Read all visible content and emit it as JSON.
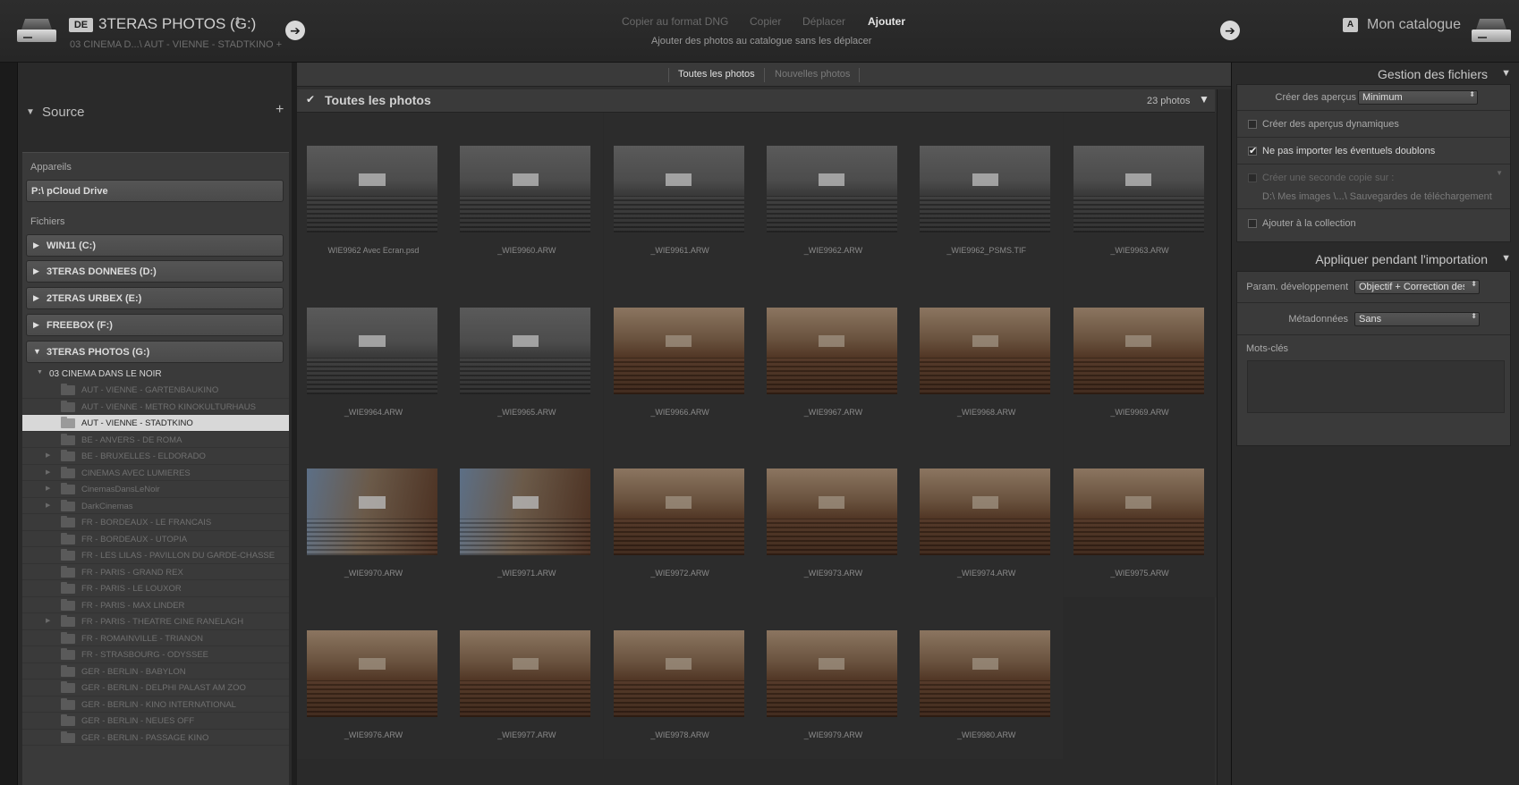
{
  "source": {
    "badge": "DE",
    "title": "3TERAS PHOTOS (G:)",
    "updown": "⬍",
    "path": "03 CINEMA D...\\ AUT - VIENNE - STADTKINO +"
  },
  "modes": {
    "dng": "Copier au format DNG",
    "copy": "Copier",
    "move": "Déplacer",
    "add": "Ajouter",
    "description": "Ajouter des photos au catalogue sans les déplacer"
  },
  "destination": {
    "badge": "A",
    "title": "Mon catalogue"
  },
  "left": {
    "source_title": "Source",
    "add_icon": "+",
    "devices_label": "Appareils",
    "devices": [
      "P:\\ pCloud Drive"
    ],
    "files_label": "Fichiers",
    "drives": [
      {
        "tri": "▶",
        "label": "WIN11 (C:)"
      },
      {
        "tri": "▶",
        "label": "3TERAS DONNEES (D:)"
      },
      {
        "tri": "▶",
        "label": "2TERAS URBEX (E:)"
      },
      {
        "tri": "▶",
        "label": "FREEBOX (F:)"
      },
      {
        "tri": "▼",
        "label": "3TERAS PHOTOS (G:)"
      }
    ],
    "root_folder": "03 CINEMA DANS LE NOIR",
    "folders": [
      {
        "label": "AUT - VIENNE - GARTENBAUKINO",
        "expandable": false
      },
      {
        "label": "AUT - VIENNE - METRO KINOKULTURHAUS",
        "expandable": false
      },
      {
        "label": "AUT - VIENNE - STADTKINO",
        "expandable": false,
        "selected": true
      },
      {
        "label": "BE - ANVERS - DE ROMA",
        "expandable": false
      },
      {
        "label": "BE - BRUXELLES - ELDORADO",
        "expandable": true
      },
      {
        "label": "CINEMAS AVEC LUMIERES",
        "expandable": true
      },
      {
        "label": "CinemasDansLeNoir",
        "expandable": true
      },
      {
        "label": "DarkCinemas",
        "expandable": true
      },
      {
        "label": "FR - BORDEAUX - LE FRANCAIS",
        "expandable": false
      },
      {
        "label": "FR - BORDEAUX - UTOPIA",
        "expandable": false
      },
      {
        "label": "FR - LES LILAS - PAVILLON DU GARDE-CHASSE",
        "expandable": false
      },
      {
        "label": "FR - PARIS - GRAND REX",
        "expandable": false
      },
      {
        "label": "FR - PARIS - LE LOUXOR",
        "expandable": false
      },
      {
        "label": "FR - PARIS - MAX LINDER",
        "expandable": false
      },
      {
        "label": "FR - PARIS - THEATRE CINE RANELAGH",
        "expandable": true
      },
      {
        "label": "FR - ROMAINVILLE - TRIANON",
        "expandable": false
      },
      {
        "label": "FR - STRASBOURG - ODYSSEE",
        "expandable": false
      },
      {
        "label": "GER - BERLIN - BABYLON",
        "expandable": false
      },
      {
        "label": "GER - BERLIN - DELPHI PALAST AM ZOO",
        "expandable": false
      },
      {
        "label": "GER - BERLIN - KINO INTERNATIONAL",
        "expandable": false
      },
      {
        "label": "GER - BERLIN - NEUES OFF",
        "expandable": false
      },
      {
        "label": "GER - BERLIN - PASSAGE KINO",
        "expandable": false
      }
    ]
  },
  "center": {
    "tab_all": "Toutes les photos",
    "tab_new": "Nouvelles photos",
    "grid_check": "✔",
    "grid_title": "Toutes les photos",
    "grid_count": "23 photos",
    "photos": [
      {
        "name": "WIE9962 Avec Ecran.psd",
        "tone": "grey"
      },
      {
        "name": "_WIE9960.ARW",
        "tone": "grey"
      },
      {
        "name": "_WIE9961.ARW",
        "tone": "grey"
      },
      {
        "name": "_WIE9962.ARW",
        "tone": "grey"
      },
      {
        "name": "_WIE9962_PSMS.TIF",
        "tone": "grey"
      },
      {
        "name": "_WIE9963.ARW",
        "tone": "grey"
      },
      {
        "name": "_WIE9964.ARW",
        "tone": "grey"
      },
      {
        "name": "_WIE9965.ARW",
        "tone": "grey"
      },
      {
        "name": "_WIE9966.ARW",
        "tone": "warm"
      },
      {
        "name": "_WIE9967.ARW",
        "tone": "warm"
      },
      {
        "name": "_WIE9968.ARW",
        "tone": "warm"
      },
      {
        "name": "_WIE9969.ARW",
        "tone": "warm"
      },
      {
        "name": "_WIE9970.ARW",
        "tone": "blue"
      },
      {
        "name": "_WIE9971.ARW",
        "tone": "blue"
      },
      {
        "name": "_WIE9972.ARW",
        "tone": "warm"
      },
      {
        "name": "_WIE9973.ARW",
        "tone": "warm"
      },
      {
        "name": "_WIE9974.ARW",
        "tone": "warm"
      },
      {
        "name": "_WIE9975.ARW",
        "tone": "warm"
      },
      {
        "name": "_WIE9976.ARW",
        "tone": "warm"
      },
      {
        "name": "_WIE9977.ARW",
        "tone": "warm"
      },
      {
        "name": "_WIE9978.ARW",
        "tone": "warm"
      },
      {
        "name": "_WIE9979.ARW",
        "tone": "warm"
      },
      {
        "name": "_WIE9980.ARW",
        "tone": "warm"
      }
    ]
  },
  "right": {
    "file_handling_title": "Gestion des fichiers",
    "previews_label": "Créer des aperçus",
    "previews_value": "Minimum",
    "smart_previews_label": "Créer des aperçus dynamiques",
    "smart_previews_checked": false,
    "no_duplicates_label": "Ne pas importer les éventuels doublons",
    "no_duplicates_checked": true,
    "second_copy_label": "Créer une seconde copie sur :",
    "second_copy_path": "D:\\ Mes images \\...\\ Sauvegardes de téléchargement",
    "add_collection_label": "Ajouter à la collection",
    "apply_title": "Appliquer pendant l'importation",
    "dev_label": "Param. développement",
    "dev_value": "Objectif + Correction des...",
    "meta_label": "Métadonnées",
    "meta_value": "Sans",
    "keywords_label": "Mots-clés",
    "checkmark": "✔"
  },
  "icons": {
    "arrow": "➔",
    "triangle_down": "▼",
    "select_arrows": "⬍"
  }
}
